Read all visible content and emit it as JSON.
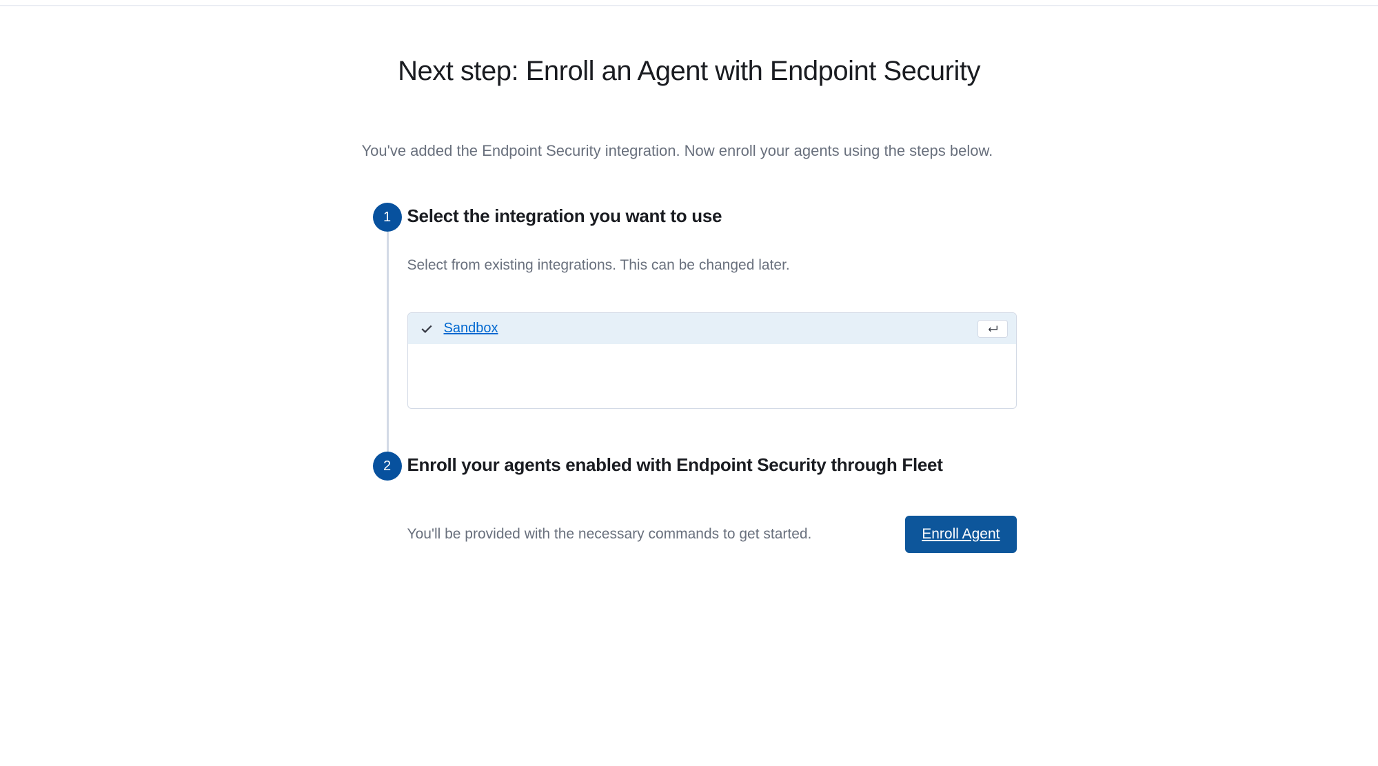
{
  "page": {
    "title": "Next step: Enroll an Agent with Endpoint Security",
    "subtitle": "You've added the Endpoint Security integration. Now enroll your agents using the steps below."
  },
  "steps": [
    {
      "number": "1",
      "title": "Select the integration you want to use",
      "description": "Select from existing integrations. This can be changed later.",
      "select": {
        "options": [
          {
            "label": "Sandbox",
            "selected": true
          }
        ]
      }
    },
    {
      "number": "2",
      "title": "Enroll your agents enabled with Endpoint Security through Fleet",
      "description": "You'll be provided with the necessary commands to get started.",
      "action_label": "Enroll Agent"
    }
  ]
}
